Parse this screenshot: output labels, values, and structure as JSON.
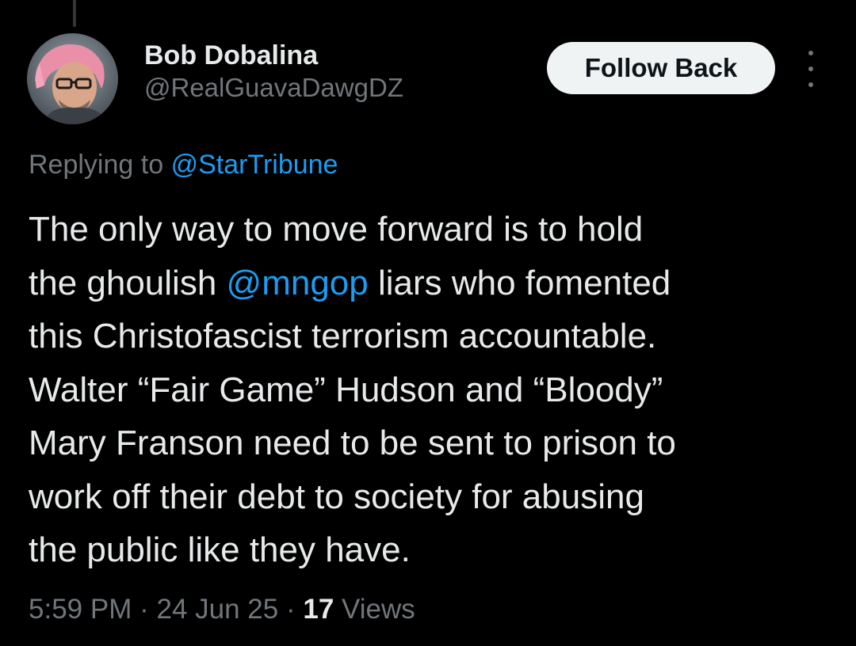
{
  "tweet": {
    "author": {
      "display_name": "Bob Dobalina",
      "handle": "@RealGuavaDawgDZ",
      "avatar_icon": "profile-photo"
    },
    "follow_label": "Follow Back",
    "more_icon": "more-vertical-icon",
    "reply_context": {
      "prefix": "Replying to",
      "mention": "@StarTribune"
    },
    "text_lines": [
      {
        "parts": [
          {
            "text": "The only way to move forward is to hold"
          }
        ]
      },
      {
        "parts": [
          {
            "text": "the ghoulish "
          },
          {
            "text": "@mngop",
            "mention": true
          },
          {
            "text": " liars who fomented"
          }
        ]
      },
      {
        "parts": [
          {
            "text": "this Christofascist terrorism accountable."
          }
        ]
      },
      {
        "parts": [
          {
            "text": "Walter “Fair Game” Hudson and “Bloody”"
          }
        ]
      },
      {
        "parts": [
          {
            "text": "Mary Franson need to be sent to prison to"
          }
        ]
      },
      {
        "parts": [
          {
            "text": "work off their debt to society for abusing"
          }
        ]
      },
      {
        "parts": [
          {
            "text": "the public like they have."
          }
        ]
      }
    ],
    "meta": {
      "time": "5:59 PM",
      "separator": "·",
      "date": "24 Jun 25",
      "views_count": "17",
      "views_label": "Views"
    }
  },
  "colors": {
    "background": "#000000",
    "primary_text": "#e7e9ea",
    "secondary_text": "#71767b",
    "link": "#1d9bf0",
    "button_bg": "#eff3f4",
    "button_text": "#0f1419"
  }
}
